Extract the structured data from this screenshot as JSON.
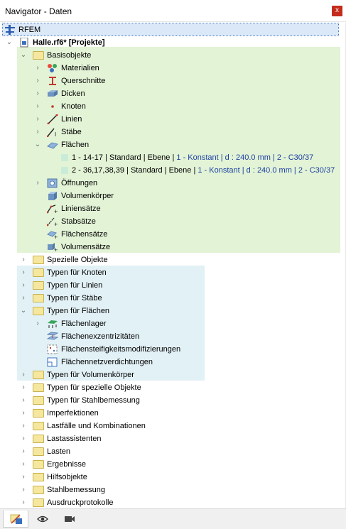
{
  "window": {
    "title": "Navigator - Daten",
    "close_label": "x"
  },
  "tree": {
    "root": "RFEM",
    "project": "Halle.rf6* [Projekte]",
    "basisobjekte": {
      "label": "Basisobjekte",
      "items": [
        "Materialien",
        "Querschnitte",
        "Dicken",
        "Knoten",
        "Linien",
        "Stäbe"
      ],
      "flaechen": {
        "label": "Flächen",
        "rows": [
          {
            "a": "1 - 14-17 | Standard | Ebene | ",
            "b": "1 - Konstant | d : 240.0 mm | 2 - C30/37"
          },
          {
            "a": "2 - 36,17,38,39 | Standard | Ebene | ",
            "b": "1 - Konstant | d : 240.0 mm | 2 - C30/37"
          }
        ]
      },
      "after": [
        "Öffnungen",
        "Volumenkörper",
        "Liniensätze",
        "Stabsätze",
        "Flächensätze",
        "Volumensätze"
      ]
    },
    "spezielle": "Spezielle Objekte",
    "typen": [
      "Typen für Knoten",
      "Typen für Linien",
      "Typen für Stäbe"
    ],
    "typen_flaechen": {
      "label": "Typen für Flächen",
      "items": [
        "Flächenlager",
        "Flächenexzentrizitäten",
        "Flächensteifigkeitsmodifizierungen",
        "Flächennetzverdichtungen"
      ]
    },
    "rest": [
      "Typen für Volumenkörper",
      "Typen für spezielle Objekte",
      "Typen für Stahlbemessung",
      "Imperfektionen",
      "Lastfälle und Kombinationen",
      "Lastassistenten",
      "Lasten",
      "Ergebnisse",
      "Hilfsobjekte",
      "Stahlbemessung",
      "Ausdruckprotokolle"
    ]
  },
  "colors": {
    "green_band": "#e3f3d6",
    "blue_band": "#e2f1f6",
    "link_blue": "#1a3fa0",
    "close": "#c42b1c"
  },
  "bottom_tabs": [
    "data-icon",
    "eye-icon",
    "camera-icon"
  ]
}
